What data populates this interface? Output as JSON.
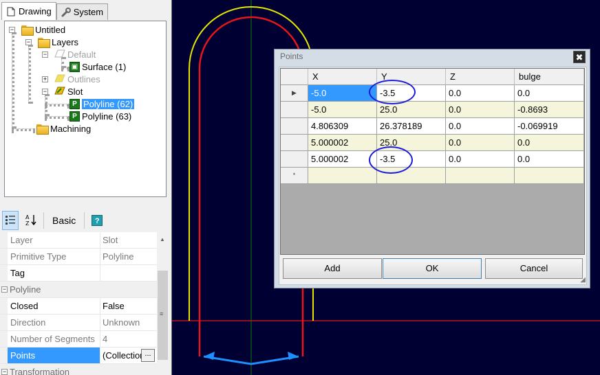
{
  "tabs": [
    {
      "label": "Drawing",
      "icon": "document-icon"
    },
    {
      "label": "System",
      "icon": "wrench-icon"
    }
  ],
  "tree": {
    "root": "Untitled",
    "layers": "Layers",
    "default": "Default",
    "surface": "Surface (1)",
    "outlines": "Outlines",
    "slot": "Slot",
    "polyline62": "Polyline (62)",
    "polyline63": "Polyline (63)",
    "machining": "Machining"
  },
  "toolbar": {
    "categorized": "categorized-icon",
    "alphabetical": "sort-alpha-icon",
    "basic_label": "Basic",
    "help": "help-icon",
    "help_glyph": "?"
  },
  "props": {
    "layer": {
      "name": "Layer",
      "value": "Slot"
    },
    "primitive_type": {
      "name": "Primitive Type",
      "value": "Polyline"
    },
    "tag": {
      "name": "Tag",
      "value": ""
    },
    "cat_polyline": "Polyline",
    "closed": {
      "name": "Closed",
      "value": "False"
    },
    "direction": {
      "name": "Direction",
      "value": "Unknown"
    },
    "segments": {
      "name": "Number of Segments",
      "value": "4"
    },
    "points": {
      "name": "Points",
      "value": "(Collection)"
    },
    "cat_transformation": "Transformation",
    "ellipsis": "..."
  },
  "dialog": {
    "title": "Points",
    "close_glyph": "✖",
    "columns": [
      "X",
      "Y",
      "Z",
      "bulge"
    ],
    "rows": [
      [
        "-5.0",
        "-3.5",
        "0.0",
        "0.0"
      ],
      [
        "-5.0",
        "25.0",
        "0.0",
        "-0.8693"
      ],
      [
        "4.806309",
        "26.378189",
        "0.0",
        "-0.069919"
      ],
      [
        "5.000002",
        "25.0",
        "0.0",
        "0.0"
      ],
      [
        "5.000002",
        "-3.5",
        "0.0",
        "0.0"
      ]
    ],
    "current_row_marker": "▶",
    "new_row_marker": "*",
    "buttons": {
      "add": "Add",
      "ok": "OK",
      "cancel": "Cancel"
    }
  },
  "colors": {
    "canvas_bg": "#000033",
    "path_red": "#e8151b",
    "path_yellow": "#e6e600",
    "axis_green": "#0a7a0a",
    "arrow_blue": "#1e8fff",
    "annotation_circle": "#1a1adf",
    "selection": "#3399ff"
  }
}
